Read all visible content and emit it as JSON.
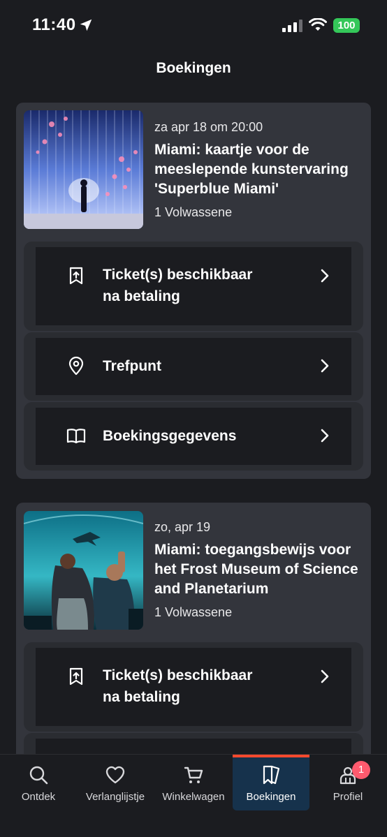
{
  "status_bar": {
    "time": "11:40",
    "battery": "100"
  },
  "header": {
    "title": "Boekingen"
  },
  "bookings": [
    {
      "date": "za apr 18 om 20:00",
      "title": "Miami: kaartje voor de meeslepende kunstervaring 'Superblue Miami'",
      "quantity": "1 Volwassene",
      "actions": [
        {
          "label_line1": "Ticket(s) beschikbaar",
          "label_line2": "na betaling",
          "icon": "ticket-icon"
        },
        {
          "label": "Trefpunt",
          "icon": "location-pin-icon"
        },
        {
          "label": "Boekingsgegevens",
          "icon": "book-icon"
        }
      ]
    },
    {
      "date": "zo, apr 19",
      "title": "Miami: toegangsbewijs voor het Frost Museum of Science and Planetarium",
      "quantity": "1 Volwassene",
      "actions": [
        {
          "label_line1": "Ticket(s) beschikbaar",
          "label_line2": "na betaling",
          "icon": "ticket-icon"
        }
      ]
    }
  ],
  "tab_bar": {
    "tabs": [
      {
        "label": "Ontdek",
        "icon": "search-icon"
      },
      {
        "label": "Verlanglijstje",
        "icon": "heart-icon"
      },
      {
        "label": "Winkelwagen",
        "icon": "cart-icon"
      },
      {
        "label": "Boekingen",
        "icon": "bookings-icon",
        "active": true
      },
      {
        "label": "Profiel",
        "icon": "profile-icon",
        "badge": "1"
      }
    ],
    "active_color": "#ff4a2e"
  },
  "colors": {
    "background": "#1b1c20",
    "card": "#33353c",
    "battery": "#34c759",
    "badge": "#ff5a6e"
  }
}
